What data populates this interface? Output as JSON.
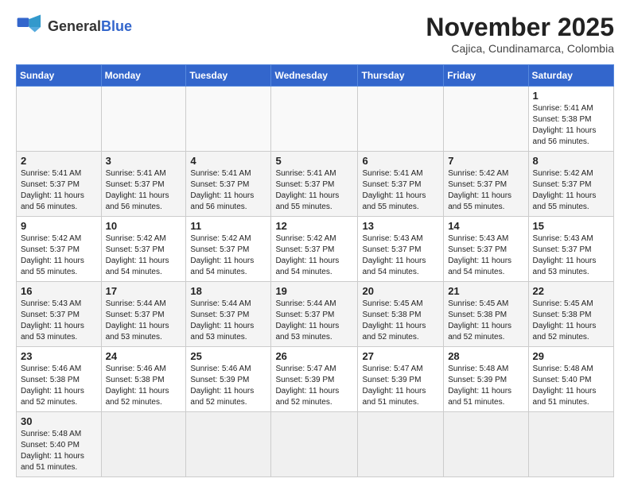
{
  "header": {
    "logo_text_normal": "General",
    "logo_text_bold": "Blue",
    "month_title": "November 2025",
    "location": "Cajica, Cundinamarca, Colombia"
  },
  "weekdays": [
    "Sunday",
    "Monday",
    "Tuesday",
    "Wednesday",
    "Thursday",
    "Friday",
    "Saturday"
  ],
  "weeks": [
    [
      {
        "day": "",
        "info": ""
      },
      {
        "day": "",
        "info": ""
      },
      {
        "day": "",
        "info": ""
      },
      {
        "day": "",
        "info": ""
      },
      {
        "day": "",
        "info": ""
      },
      {
        "day": "",
        "info": ""
      },
      {
        "day": "1",
        "info": "Sunrise: 5:41 AM\nSunset: 5:38 PM\nDaylight: 11 hours and 56 minutes."
      }
    ],
    [
      {
        "day": "2",
        "info": "Sunrise: 5:41 AM\nSunset: 5:37 PM\nDaylight: 11 hours and 56 minutes."
      },
      {
        "day": "3",
        "info": "Sunrise: 5:41 AM\nSunset: 5:37 PM\nDaylight: 11 hours and 56 minutes."
      },
      {
        "day": "4",
        "info": "Sunrise: 5:41 AM\nSunset: 5:37 PM\nDaylight: 11 hours and 56 minutes."
      },
      {
        "day": "5",
        "info": "Sunrise: 5:41 AM\nSunset: 5:37 PM\nDaylight: 11 hours and 55 minutes."
      },
      {
        "day": "6",
        "info": "Sunrise: 5:41 AM\nSunset: 5:37 PM\nDaylight: 11 hours and 55 minutes."
      },
      {
        "day": "7",
        "info": "Sunrise: 5:42 AM\nSunset: 5:37 PM\nDaylight: 11 hours and 55 minutes."
      },
      {
        "day": "8",
        "info": "Sunrise: 5:42 AM\nSunset: 5:37 PM\nDaylight: 11 hours and 55 minutes."
      }
    ],
    [
      {
        "day": "9",
        "info": "Sunrise: 5:42 AM\nSunset: 5:37 PM\nDaylight: 11 hours and 55 minutes."
      },
      {
        "day": "10",
        "info": "Sunrise: 5:42 AM\nSunset: 5:37 PM\nDaylight: 11 hours and 54 minutes."
      },
      {
        "day": "11",
        "info": "Sunrise: 5:42 AM\nSunset: 5:37 PM\nDaylight: 11 hours and 54 minutes."
      },
      {
        "day": "12",
        "info": "Sunrise: 5:42 AM\nSunset: 5:37 PM\nDaylight: 11 hours and 54 minutes."
      },
      {
        "day": "13",
        "info": "Sunrise: 5:43 AM\nSunset: 5:37 PM\nDaylight: 11 hours and 54 minutes."
      },
      {
        "day": "14",
        "info": "Sunrise: 5:43 AM\nSunset: 5:37 PM\nDaylight: 11 hours and 54 minutes."
      },
      {
        "day": "15",
        "info": "Sunrise: 5:43 AM\nSunset: 5:37 PM\nDaylight: 11 hours and 53 minutes."
      }
    ],
    [
      {
        "day": "16",
        "info": "Sunrise: 5:43 AM\nSunset: 5:37 PM\nDaylight: 11 hours and 53 minutes."
      },
      {
        "day": "17",
        "info": "Sunrise: 5:44 AM\nSunset: 5:37 PM\nDaylight: 11 hours and 53 minutes."
      },
      {
        "day": "18",
        "info": "Sunrise: 5:44 AM\nSunset: 5:37 PM\nDaylight: 11 hours and 53 minutes."
      },
      {
        "day": "19",
        "info": "Sunrise: 5:44 AM\nSunset: 5:37 PM\nDaylight: 11 hours and 53 minutes."
      },
      {
        "day": "20",
        "info": "Sunrise: 5:45 AM\nSunset: 5:38 PM\nDaylight: 11 hours and 52 minutes."
      },
      {
        "day": "21",
        "info": "Sunrise: 5:45 AM\nSunset: 5:38 PM\nDaylight: 11 hours and 52 minutes."
      },
      {
        "day": "22",
        "info": "Sunrise: 5:45 AM\nSunset: 5:38 PM\nDaylight: 11 hours and 52 minutes."
      }
    ],
    [
      {
        "day": "23",
        "info": "Sunrise: 5:46 AM\nSunset: 5:38 PM\nDaylight: 11 hours and 52 minutes."
      },
      {
        "day": "24",
        "info": "Sunrise: 5:46 AM\nSunset: 5:38 PM\nDaylight: 11 hours and 52 minutes."
      },
      {
        "day": "25",
        "info": "Sunrise: 5:46 AM\nSunset: 5:39 PM\nDaylight: 11 hours and 52 minutes."
      },
      {
        "day": "26",
        "info": "Sunrise: 5:47 AM\nSunset: 5:39 PM\nDaylight: 11 hours and 52 minutes."
      },
      {
        "day": "27",
        "info": "Sunrise: 5:47 AM\nSunset: 5:39 PM\nDaylight: 11 hours and 51 minutes."
      },
      {
        "day": "28",
        "info": "Sunrise: 5:48 AM\nSunset: 5:39 PM\nDaylight: 11 hours and 51 minutes."
      },
      {
        "day": "29",
        "info": "Sunrise: 5:48 AM\nSunset: 5:40 PM\nDaylight: 11 hours and 51 minutes."
      }
    ],
    [
      {
        "day": "30",
        "info": "Sunrise: 5:48 AM\nSunset: 5:40 PM\nDaylight: 11 hours and 51 minutes."
      },
      {
        "day": "",
        "info": ""
      },
      {
        "day": "",
        "info": ""
      },
      {
        "day": "",
        "info": ""
      },
      {
        "day": "",
        "info": ""
      },
      {
        "day": "",
        "info": ""
      },
      {
        "day": "",
        "info": ""
      }
    ]
  ]
}
